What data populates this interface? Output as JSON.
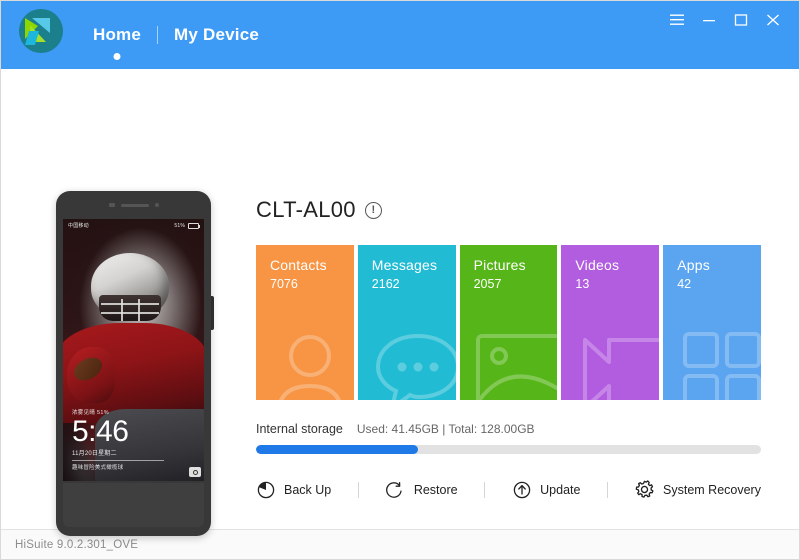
{
  "window": {
    "brand_logo": "hisuite-logo",
    "nav": [
      {
        "label": "Home",
        "active": true
      },
      {
        "label": "My Device",
        "active": false
      }
    ],
    "controls": [
      {
        "name": "menu-button",
        "icon": "hamburger-icon"
      },
      {
        "name": "minimize-button",
        "icon": "minimize-icon"
      },
      {
        "name": "maximize-button",
        "icon": "maximize-icon"
      },
      {
        "name": "close-button",
        "icon": "close-icon"
      }
    ],
    "accent_color": "#3d9bf5"
  },
  "phone_preview": {
    "status_left": "中国移动",
    "status_right": "51%",
    "weather": "浓雾见晴 51%",
    "time": "5:46",
    "date": "11月20日星期二",
    "quote": "趣味冒险美式橄榄球",
    "camera_icon": "camera-icon"
  },
  "device": {
    "name": "CLT-AL00",
    "info_icon": "info-icon",
    "info_glyph": "!"
  },
  "tiles": [
    {
      "label": "Contacts",
      "count": "7076",
      "color": "#f79545",
      "icon": "contacts-icon"
    },
    {
      "label": "Messages",
      "count": "2162",
      "color": "#21bcd4",
      "icon": "messages-icon"
    },
    {
      "label": "Pictures",
      "count": "2057",
      "color": "#56b518",
      "icon": "pictures-icon"
    },
    {
      "label": "Videos",
      "count": "13",
      "color": "#b25ce0",
      "icon": "videos-icon"
    },
    {
      "label": "Apps",
      "count": "42",
      "color": "#5ba4f0",
      "icon": "apps-icon"
    }
  ],
  "storage": {
    "label": "Internal storage",
    "detail": "Used: 41.45GB | Total: 128.00GB",
    "used_gb": 41.45,
    "total_gb": 128.0,
    "percent": 32,
    "fill_color": "#1f7ae8",
    "track_color": "#e2e2e2"
  },
  "actions": [
    {
      "label": "Back Up",
      "icon": "backup-clock-icon"
    },
    {
      "label": "Restore",
      "icon": "restore-circular-arrow-icon"
    },
    {
      "label": "Update",
      "icon": "update-up-arrow-circle-icon"
    },
    {
      "label": "System Recovery",
      "icon": "gear-icon"
    }
  ],
  "statusbar": {
    "version": "HiSuite 9.0.2.301_OVE"
  }
}
